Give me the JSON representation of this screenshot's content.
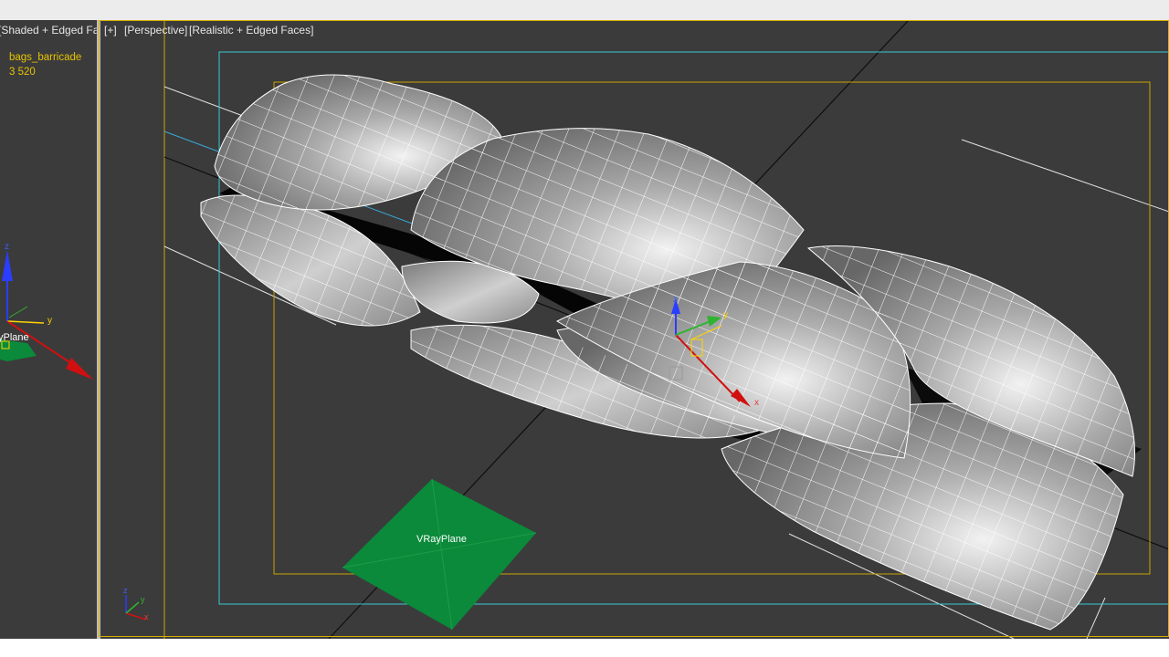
{
  "left_viewport": {
    "label": "[Shaded + Edged Fac",
    "object_name": "bags_barricade",
    "poly_count": "3 520",
    "object_label": "yPlane"
  },
  "main_viewport": {
    "menu": {
      "plus": "[+]",
      "view": "[Perspective]",
      "shading": "[Realistic + Edged Faces]"
    },
    "object_label": "VRayPlane"
  },
  "gizmo": {
    "x": "x",
    "y": "y",
    "z": "z"
  },
  "colors": {
    "viewport_bg": "#3b3b3b",
    "active_border": "#d8b000",
    "safe_frame_outer": "#38c9d6",
    "safe_frame_inner": "#c9a400",
    "plane": "#0a8a3a"
  }
}
